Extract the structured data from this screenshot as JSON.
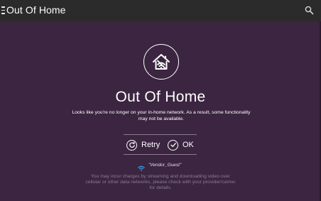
{
  "header": {
    "title": "Out Of Home",
    "menu_icon": "hamburger-menu-icon",
    "search_icon": "search-icon"
  },
  "main": {
    "status_icon": "home-no-wifi-icon",
    "title": "Out Of Home",
    "message": "Looks like you're no longer on your in-home network. As a result, some functionality may not be available.",
    "buttons": {
      "retry_label": "Retry",
      "ok_label": "OK"
    },
    "network": {
      "icon": "wifi-icon",
      "name": "\"Vendor_Guest\""
    },
    "disclaimer": "You may incur charges by streaming and downloading video over cellular or other data networks, please check with your provider/carrier for details."
  },
  "colors": {
    "background": "#3b2540",
    "header_bg": "#2b2b2b",
    "wifi_accent": "#3aa0e8",
    "disclaimer_text": "#8c7b8f"
  }
}
